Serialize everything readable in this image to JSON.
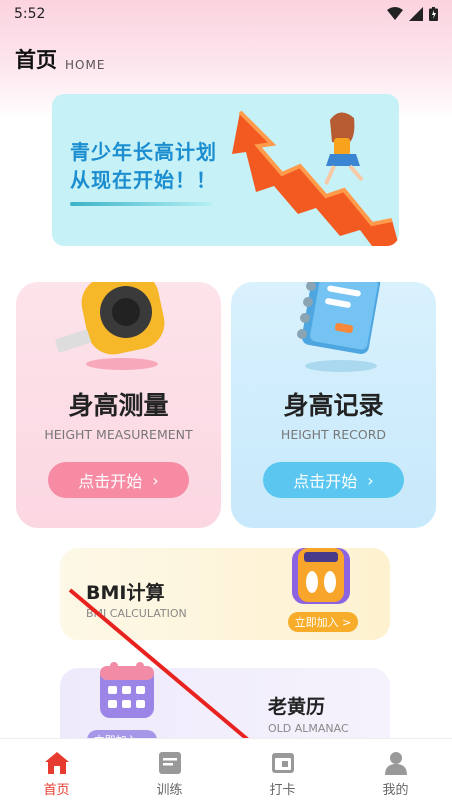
{
  "status": {
    "time": "5:52"
  },
  "header": {
    "title": "首页",
    "subtitle": "HOME"
  },
  "banner": {
    "line1": "青少年长高计划",
    "line2": "从现在开始！！"
  },
  "cards": [
    {
      "title": "身高测量",
      "subtitle": "HEIGHT MEASUREMENT",
      "button": "点击开始"
    },
    {
      "title": "身高记录",
      "subtitle": "HEIGHT RECORD",
      "button": "点击开始"
    }
  ],
  "bmi": {
    "title": "BMI计算",
    "subtitle": "BMI CALCULATION",
    "join": "立即加入 >"
  },
  "almanac": {
    "title": "老黄历",
    "subtitle": "OLD ALMANAC",
    "join": "立即加入 >"
  },
  "tabs": [
    {
      "label": "首页",
      "icon": "home-icon",
      "active": true
    },
    {
      "label": "训练",
      "icon": "training-icon"
    },
    {
      "label": "打卡",
      "icon": "checkin-icon"
    },
    {
      "label": "我的",
      "icon": "profile-icon"
    }
  ],
  "colors": {
    "accent": "#e63b2e",
    "pink": "#f78ba4",
    "blue": "#5bc7f0",
    "annotation": "#e8231f"
  }
}
